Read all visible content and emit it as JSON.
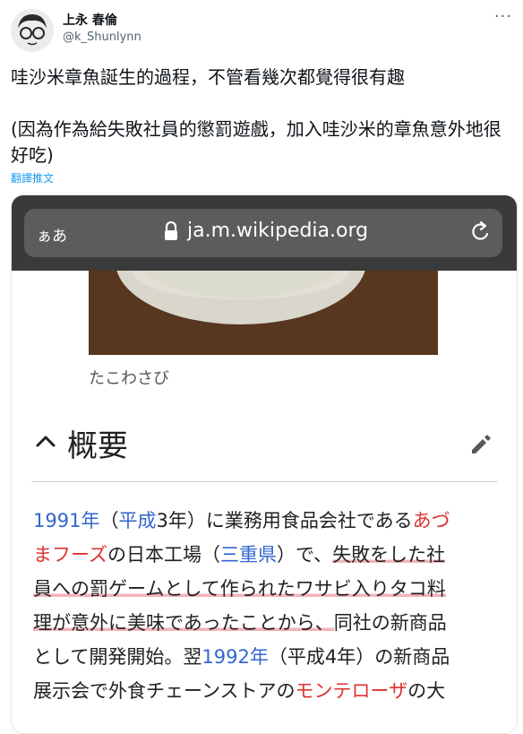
{
  "tweet": {
    "display_name": "上永 春倫",
    "handle": "@k_Shunlynn",
    "text_line1": "哇沙米章魚誕生的過程，不管看幾次都覺得很有趣",
    "text_line2": "(因為作為給失敗社員的懲罰遊戲，加入哇沙米的章魚意外地很好吃)",
    "translate_label": "翻譯推文",
    "more_label": "···"
  },
  "browser": {
    "aa_label": "ぁあ",
    "domain": "ja.m.wikipedia.org"
  },
  "wiki": {
    "image_caption": "たこわさび",
    "section_title": "概要",
    "article": {
      "l1_a": "1991年",
      "l1_b": "（",
      "l1_c": "平成",
      "l1_d": "3年）に業務用食品会社である",
      "l1_e": "あづ",
      "l2_a": "まフーズ",
      "l2_b": "の日本工場（",
      "l2_c": "三重県",
      "l2_d": "）で、",
      "l2_e": "失敗をした社",
      "l3_a": "員への罰ゲームとして作られたワサビ入りタコ料",
      "l4_a": "理が意外に美味であったことから、",
      "l4_b": "同社の新商品",
      "l5_a": "として開発開始。翌",
      "l5_b": "1992年",
      "l5_c": "（平成4年）の新商品",
      "l6_a": "展示会で外食チェーンストアの",
      "l6_b": "モンテローザ",
      "l6_c": "の大"
    }
  },
  "colors": {
    "link": "#3366cc",
    "redlink": "#dd3333",
    "highlight": "#e87484",
    "twitter_blue": "#1d9bf0"
  }
}
